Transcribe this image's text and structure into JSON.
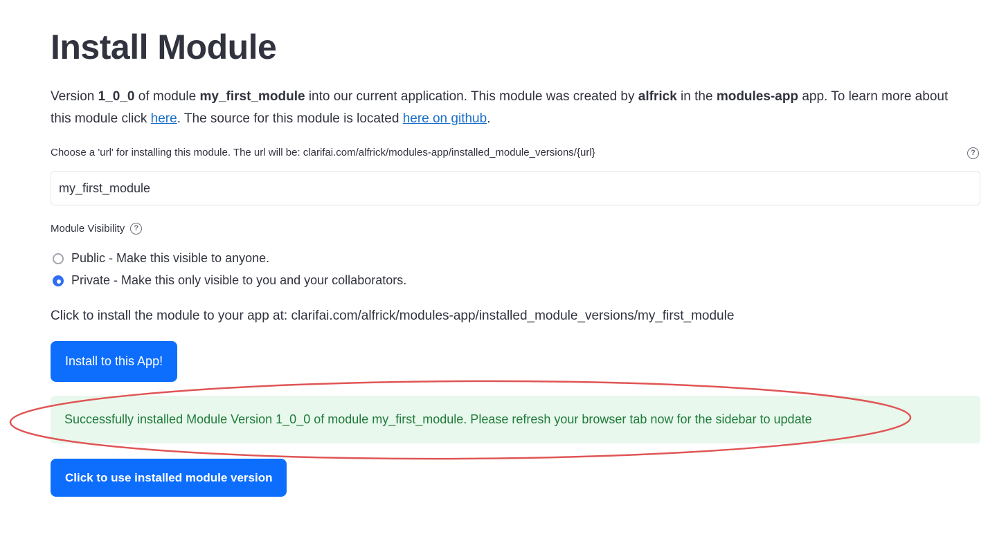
{
  "page": {
    "title": "Install Module"
  },
  "intro": {
    "p1": "Version ",
    "version": "1_0_0",
    "p2": " of module ",
    "module": "my_first_module",
    "p3": " into our current application. This module was created by ",
    "author": "alfrick",
    "p4": " in the ",
    "app": "modules-app",
    "p5": " app. To learn more about this module click ",
    "link_here": "here",
    "p6": ". The source for this module is located ",
    "link_github": "here on github",
    "p7": "."
  },
  "url_field": {
    "label": "Choose a 'url' for installing this module. The url will be: clarifai.com/alfrick/modules-app/installed_module_versions/{url}",
    "value": "my_first_module",
    "help_glyph": "?",
    "help_icon": "question-circle-icon"
  },
  "visibility": {
    "label": "Module Visibility",
    "help_glyph": "?",
    "options": [
      {
        "label": "Public - Make this visible to anyone.",
        "selected": false
      },
      {
        "label": "Private - Make this only visible to you and your collaborators.",
        "selected": true
      }
    ]
  },
  "install": {
    "text": "Click to install the module to your app at: clarifai.com/alfrick/modules-app/installed_module_versions/my_first_module",
    "button_label": "Install to this App!"
  },
  "success": {
    "message": "Successfully installed Module Version 1_0_0 of module my_first_module. Please refresh your browser tab now for the sidebar to update"
  },
  "use_button": {
    "label": "Click to use installed module version"
  },
  "colors": {
    "primary": "#0d6efd",
    "success_bg": "#e8f8ec",
    "success_text": "#1f7a3b",
    "annotation": "#e05555",
    "link": "#1a6fc9"
  }
}
